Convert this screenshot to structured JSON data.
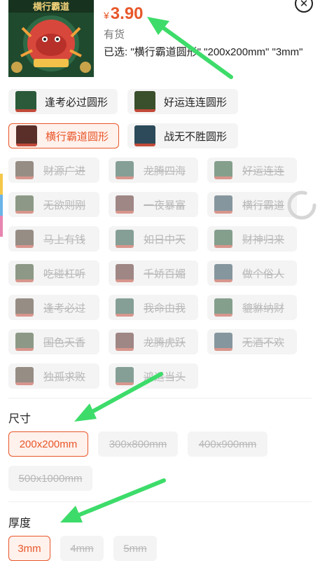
{
  "product": {
    "currency": "¥",
    "price": "3.90",
    "stock": "有货",
    "selected_text": "已选: \"横行霸道圆形\" \"200x200mm\" \"3mm\"",
    "thumb_title": "横行霸道"
  },
  "colors": {
    "accent": "#e8572a",
    "chip_bg": "#f4f4f4",
    "disabled_text": "#b8b8b8",
    "arrow": "#3ddc6a"
  },
  "style_options": [
    {
      "label": "逢考必过圆形",
      "state": "normal"
    },
    {
      "label": "好运连连圆形",
      "state": "normal"
    },
    {
      "label": "横行霸道圆形",
      "state": "selected"
    },
    {
      "label": "战无不胜圆形",
      "state": "normal"
    },
    {
      "label": "财源广进",
      "state": "disabled"
    },
    {
      "label": "龙腾四海",
      "state": "disabled"
    },
    {
      "label": "好运连连",
      "state": "disabled"
    },
    {
      "label": "无欲则刚",
      "state": "disabled"
    },
    {
      "label": "一夜暴富",
      "state": "disabled"
    },
    {
      "label": "横行霸道",
      "state": "disabled"
    },
    {
      "label": "马上有钱",
      "state": "disabled"
    },
    {
      "label": "如日中天",
      "state": "disabled"
    },
    {
      "label": "财神归来",
      "state": "disabled"
    },
    {
      "label": "吃碰杠听",
      "state": "disabled"
    },
    {
      "label": "千娇百媚",
      "state": "disabled"
    },
    {
      "label": "做个俗人",
      "state": "disabled"
    },
    {
      "label": "逢考必过",
      "state": "disabled"
    },
    {
      "label": "我命由我",
      "state": "disabled"
    },
    {
      "label": "貔貅纳财",
      "state": "disabled"
    },
    {
      "label": "国色天香",
      "state": "disabled"
    },
    {
      "label": "龙腾虎跃",
      "state": "disabled"
    },
    {
      "label": "无酒不欢",
      "state": "disabled"
    },
    {
      "label": "独孤求败",
      "state": "disabled"
    },
    {
      "label": "鸿运当头",
      "state": "disabled"
    }
  ],
  "size": {
    "title": "尺寸",
    "options": [
      {
        "label": "200x200mm",
        "state": "selected"
      },
      {
        "label": "300x800mm",
        "state": "disabled"
      },
      {
        "label": "400x900mm",
        "state": "disabled"
      },
      {
        "label": "500x1000mm",
        "state": "disabled"
      }
    ]
  },
  "thickness": {
    "title": "厚度",
    "options": [
      {
        "label": "3mm",
        "state": "selected"
      },
      {
        "label": "4mm",
        "state": "disabled"
      },
      {
        "label": "5mm",
        "state": "disabled"
      }
    ]
  }
}
